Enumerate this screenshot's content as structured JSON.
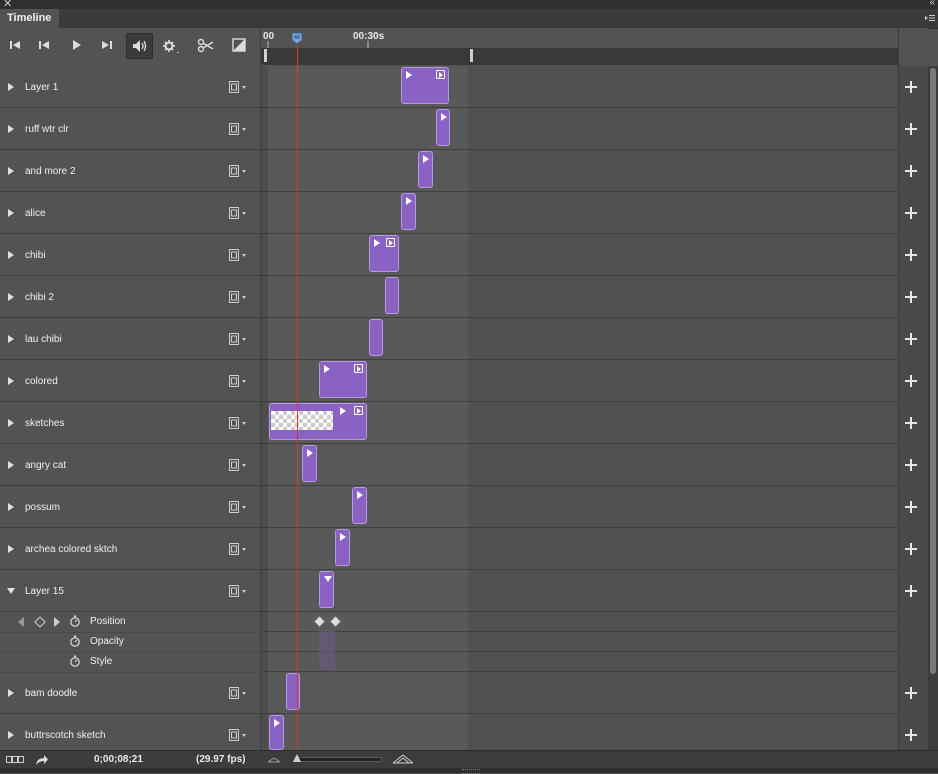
{
  "panel": {
    "title": "Timeline"
  },
  "toolbar": {
    "buttons": [
      "go-to-first-frame",
      "previous-frame",
      "play",
      "next-frame",
      "audio",
      "settings",
      "split-at-playhead",
      "transition"
    ]
  },
  "ruler": {
    "start_label": "00",
    "mark_label": "00:30s"
  },
  "layers": [
    {
      "name": "Layer 1"
    },
    {
      "name": "ruff wtr clr"
    },
    {
      "name": "and more 2"
    },
    {
      "name": "alice"
    },
    {
      "name": "chibi"
    },
    {
      "name": "chibi 2"
    },
    {
      "name": "lau chibi"
    },
    {
      "name": "colored"
    },
    {
      "name": "sketches"
    },
    {
      "name": "angry cat"
    },
    {
      "name": "possum"
    },
    {
      "name": "archea colored sktch"
    },
    {
      "name": "Layer 15",
      "expanded": true
    },
    {
      "name": "bam doodle"
    },
    {
      "name": "buttrscotch sketch"
    }
  ],
  "properties": [
    {
      "name": "Position"
    },
    {
      "name": "Opacity"
    },
    {
      "name": "Style"
    }
  ],
  "footer": {
    "timecode": "0;00;08;21",
    "fps": "(29.97 fps)"
  },
  "colors": {
    "clip": "#8a62c4",
    "playhead": "#d9372f",
    "panel": "#535353"
  }
}
